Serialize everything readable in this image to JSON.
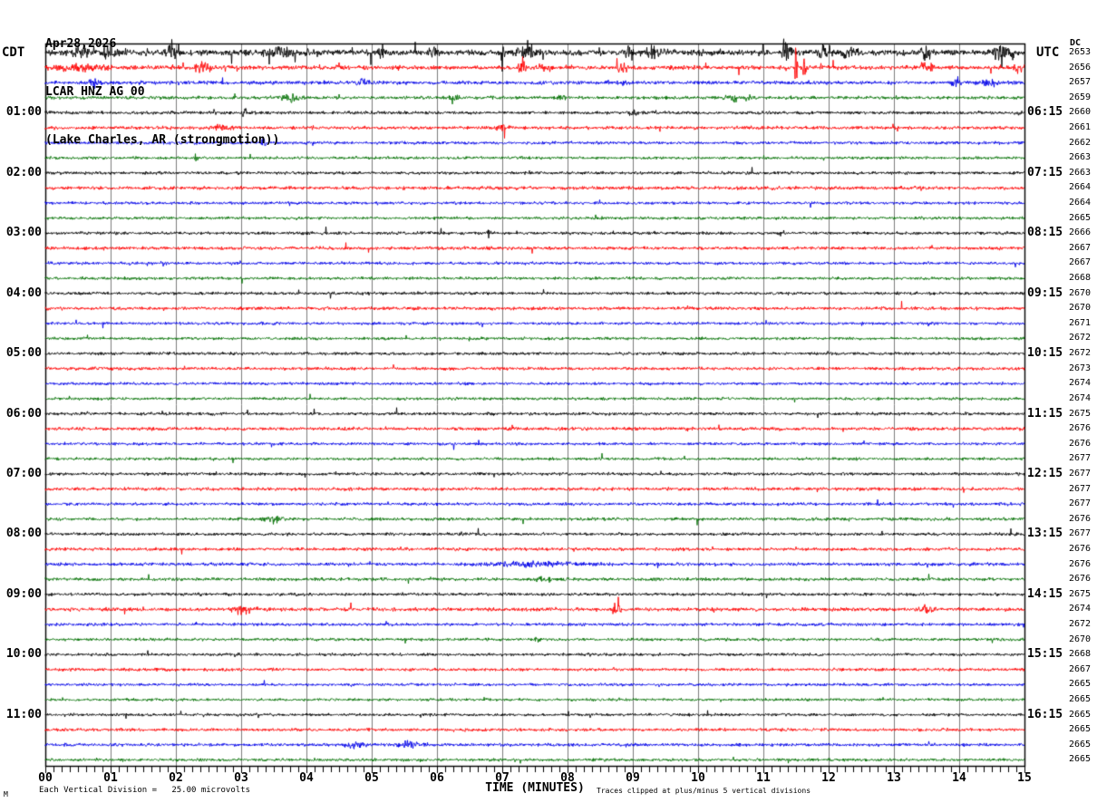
{
  "header": {
    "date_line": "Apr28,2026",
    "station_line": "LCAR HNZ AG 00",
    "location_line": "(Lake Charles, AR (strongmotion))",
    "left_timezone": "CDT",
    "right_timezone": "UTC",
    "dc_column_header": "DC"
  },
  "x_axis": {
    "title": "TIME (MINUTES)",
    "tick_labels": [
      "00",
      "01",
      "02",
      "03",
      "04",
      "05",
      "06",
      "07",
      "08",
      "09",
      "10",
      "11",
      "12",
      "13",
      "14",
      "15"
    ]
  },
  "footer": {
    "logo_mark": "M",
    "scale_label": "Each Vertical Division =",
    "scale_value": "25.00 microvolts",
    "clip_note": "Traces clipped at plus/minus 5 vertical divisions"
  },
  "colors": {
    "black": "#000000",
    "red": "#ff0000",
    "blue": "#0000e8",
    "green": "#006f00",
    "grid": "#7d7d7d",
    "border": "#000000",
    "background": "#ffffff"
  },
  "chart_data": {
    "type": "line",
    "subtype": "helicorder_seismogram",
    "minutes_per_line": 15,
    "x_range_minutes": [
      0,
      15
    ],
    "grid": "vertical-every-minute",
    "trace_color_cycle": [
      "black",
      "red",
      "blue",
      "green"
    ],
    "clip_divisions": 5,
    "microvolts_per_division": 25.0,
    "rows": [
      {
        "cdt": "",
        "utc": "",
        "dc": 2653,
        "color": "black",
        "amp": 3.0,
        "spk": 0.02,
        "events": [
          [
            0.55,
            5,
            0.08
          ],
          [
            1.0,
            7,
            0.07
          ],
          [
            1.95,
            9,
            0.06
          ],
          [
            3.6,
            4,
            0.15
          ],
          [
            5.15,
            7,
            0.04
          ],
          [
            5.95,
            5,
            0.05
          ],
          [
            7.0,
            30,
            0.015
          ],
          [
            7.35,
            6,
            0.1
          ],
          [
            8.95,
            12,
            0.03
          ],
          [
            9.3,
            5,
            0.1
          ],
          [
            11.35,
            8,
            0.05
          ],
          [
            11.9,
            8,
            0.04
          ],
          [
            12.3,
            5,
            0.1
          ],
          [
            13.5,
            6,
            0.05
          ],
          [
            14.65,
            6,
            0.1
          ]
        ]
      },
      {
        "cdt": "",
        "utc": "",
        "dc": 2656,
        "color": "red",
        "amp": 2.2,
        "spk": 0.01,
        "events": [
          [
            0.5,
            3,
            0.3
          ],
          [
            2.4,
            6,
            0.08
          ],
          [
            4.5,
            5,
            0.03
          ],
          [
            7.3,
            8,
            0.04
          ],
          [
            7.6,
            5,
            0.05
          ],
          [
            8.85,
            4,
            0.06
          ],
          [
            11.5,
            40,
            0.012
          ],
          [
            11.62,
            12,
            0.02
          ],
          [
            13.5,
            4,
            0.08
          ],
          [
            14.9,
            5,
            0.05
          ]
        ]
      },
      {
        "cdt": "",
        "utc": "",
        "dc": 2657,
        "color": "blue",
        "amp": 1.9,
        "spk": 0.008,
        "events": [
          [
            0.75,
            5,
            0.05
          ],
          [
            4.85,
            5,
            0.05
          ],
          [
            8.85,
            4,
            0.05
          ],
          [
            13.95,
            6,
            0.04
          ],
          [
            14.5,
            3,
            0.1
          ]
        ]
      },
      {
        "cdt": "",
        "utc": "",
        "dc": 2659,
        "color": "green",
        "amp": 1.7,
        "spk": 0.006,
        "events": [
          [
            3.75,
            4,
            0.1
          ],
          [
            6.25,
            6,
            0.04
          ],
          [
            7.9,
            4,
            0.05
          ],
          [
            10.6,
            3,
            0.15
          ]
        ]
      },
      {
        "cdt": "01:00",
        "utc": "06:15",
        "dc": 2660,
        "color": "black",
        "amp": 1.7,
        "spk": 0.006,
        "events": [
          [
            3.05,
            7,
            0.02
          ],
          [
            9.0,
            3,
            0.05
          ],
          [
            14.9,
            5,
            0.03
          ]
        ]
      },
      {
        "cdt": "",
        "utc": "",
        "dc": 2661,
        "color": "red",
        "amp": 1.8,
        "spk": 0.005,
        "events": [
          [
            2.7,
            3,
            0.1
          ],
          [
            7.0,
            3,
            0.05
          ]
        ]
      },
      {
        "cdt": "",
        "utc": "",
        "dc": 2662,
        "color": "blue",
        "amp": 1.6,
        "spk": 0.005,
        "events": [
          [
            3.35,
            6,
            0.025
          ]
        ]
      },
      {
        "cdt": "",
        "utc": "",
        "dc": 2663,
        "color": "green",
        "amp": 1.5,
        "spk": 0.005,
        "events": [
          [
            2.3,
            5,
            0.02
          ]
        ]
      },
      {
        "cdt": "02:00",
        "utc": "07:15",
        "dc": 2663,
        "color": "black",
        "amp": 1.6,
        "spk": 0.004,
        "events": []
      },
      {
        "cdt": "",
        "utc": "",
        "dc": 2664,
        "color": "red",
        "amp": 1.8,
        "spk": 0.005,
        "events": []
      },
      {
        "cdt": "",
        "utc": "",
        "dc": 2664,
        "color": "blue",
        "amp": 1.5,
        "spk": 0.004,
        "events": []
      },
      {
        "cdt": "",
        "utc": "",
        "dc": 2665,
        "color": "green",
        "amp": 1.5,
        "spk": 0.004,
        "events": []
      },
      {
        "cdt": "03:00",
        "utc": "08:15",
        "dc": 2666,
        "color": "black",
        "amp": 1.6,
        "spk": 0.004,
        "events": [
          [
            6.8,
            5,
            0.02
          ]
        ]
      },
      {
        "cdt": "",
        "utc": "",
        "dc": 2667,
        "color": "red",
        "amp": 1.7,
        "spk": 0.004,
        "events": []
      },
      {
        "cdt": "",
        "utc": "",
        "dc": 2667,
        "color": "blue",
        "amp": 1.5,
        "spk": 0.004,
        "events": []
      },
      {
        "cdt": "",
        "utc": "",
        "dc": 2668,
        "color": "green",
        "amp": 1.5,
        "spk": 0.004,
        "events": []
      },
      {
        "cdt": "04:00",
        "utc": "09:15",
        "dc": 2670,
        "color": "black",
        "amp": 1.6,
        "spk": 0.004,
        "events": []
      },
      {
        "cdt": "",
        "utc": "",
        "dc": 2670,
        "color": "red",
        "amp": 1.7,
        "spk": 0.004,
        "events": []
      },
      {
        "cdt": "",
        "utc": "",
        "dc": 2671,
        "color": "blue",
        "amp": 1.5,
        "spk": 0.004,
        "events": []
      },
      {
        "cdt": "",
        "utc": "",
        "dc": 2672,
        "color": "green",
        "amp": 1.5,
        "spk": 0.004,
        "events": []
      },
      {
        "cdt": "05:00",
        "utc": "10:15",
        "dc": 2672,
        "color": "black",
        "amp": 1.6,
        "spk": 0.004,
        "events": []
      },
      {
        "cdt": "",
        "utc": "",
        "dc": 2673,
        "color": "red",
        "amp": 1.7,
        "spk": 0.004,
        "events": []
      },
      {
        "cdt": "",
        "utc": "",
        "dc": 2674,
        "color": "blue",
        "amp": 1.5,
        "spk": 0.004,
        "events": []
      },
      {
        "cdt": "",
        "utc": "",
        "dc": 2674,
        "color": "green",
        "amp": 1.5,
        "spk": 0.004,
        "events": []
      },
      {
        "cdt": "06:00",
        "utc": "11:15",
        "dc": 2675,
        "color": "black",
        "amp": 1.6,
        "spk": 0.004,
        "events": []
      },
      {
        "cdt": "",
        "utc": "",
        "dc": 2676,
        "color": "red",
        "amp": 1.8,
        "spk": 0.005,
        "events": []
      },
      {
        "cdt": "",
        "utc": "",
        "dc": 2676,
        "color": "blue",
        "amp": 1.5,
        "spk": 0.004,
        "events": []
      },
      {
        "cdt": "",
        "utc": "",
        "dc": 2677,
        "color": "green",
        "amp": 1.5,
        "spk": 0.004,
        "events": []
      },
      {
        "cdt": "07:00",
        "utc": "12:15",
        "dc": 2677,
        "color": "black",
        "amp": 1.6,
        "spk": 0.004,
        "events": []
      },
      {
        "cdt": "",
        "utc": "",
        "dc": 2677,
        "color": "red",
        "amp": 1.7,
        "spk": 0.004,
        "events": []
      },
      {
        "cdt": "",
        "utc": "",
        "dc": 2677,
        "color": "blue",
        "amp": 1.6,
        "spk": 0.004,
        "events": []
      },
      {
        "cdt": "",
        "utc": "",
        "dc": 2676,
        "color": "green",
        "amp": 1.6,
        "spk": 0.004,
        "events": [
          [
            3.5,
            3,
            0.1
          ]
        ]
      },
      {
        "cdt": "08:00",
        "utc": "13:15",
        "dc": 2677,
        "color": "black",
        "amp": 1.6,
        "spk": 0.004,
        "events": []
      },
      {
        "cdt": "",
        "utc": "",
        "dc": 2676,
        "color": "red",
        "amp": 1.7,
        "spk": 0.004,
        "events": []
      },
      {
        "cdt": "",
        "utc": "",
        "dc": 2676,
        "color": "blue",
        "amp": 1.7,
        "spk": 0.005,
        "events": [
          [
            7.5,
            2,
            0.5
          ]
        ]
      },
      {
        "cdt": "",
        "utc": "",
        "dc": 2676,
        "color": "green",
        "amp": 1.7,
        "spk": 0.005,
        "events": [
          [
            7.6,
            3,
            0.1
          ]
        ]
      },
      {
        "cdt": "09:00",
        "utc": "14:15",
        "dc": 2675,
        "color": "black",
        "amp": 1.6,
        "spk": 0.004,
        "events": []
      },
      {
        "cdt": "",
        "utc": "",
        "dc": 2674,
        "color": "red",
        "amp": 1.9,
        "spk": 0.006,
        "events": [
          [
            3.0,
            5,
            0.1
          ],
          [
            8.75,
            5,
            0.05
          ],
          [
            13.5,
            4,
            0.06
          ]
        ]
      },
      {
        "cdt": "",
        "utc": "",
        "dc": 2672,
        "color": "blue",
        "amp": 1.6,
        "spk": 0.004,
        "events": []
      },
      {
        "cdt": "",
        "utc": "",
        "dc": 2670,
        "color": "green",
        "amp": 1.5,
        "spk": 0.004,
        "events": [
          [
            7.55,
            3,
            0.04
          ]
        ]
      },
      {
        "cdt": "10:00",
        "utc": "15:15",
        "dc": 2668,
        "color": "black",
        "amp": 1.5,
        "spk": 0.004,
        "events": []
      },
      {
        "cdt": "",
        "utc": "",
        "dc": 2667,
        "color": "red",
        "amp": 1.6,
        "spk": 0.004,
        "events": []
      },
      {
        "cdt": "",
        "utc": "",
        "dc": 2665,
        "color": "blue",
        "amp": 1.5,
        "spk": 0.004,
        "events": []
      },
      {
        "cdt": "",
        "utc": "",
        "dc": 2665,
        "color": "green",
        "amp": 1.4,
        "spk": 0.004,
        "events": []
      },
      {
        "cdt": "11:00",
        "utc": "16:15",
        "dc": 2665,
        "color": "black",
        "amp": 1.5,
        "spk": 0.004,
        "events": []
      },
      {
        "cdt": "",
        "utc": "",
        "dc": 2665,
        "color": "red",
        "amp": 1.6,
        "spk": 0.004,
        "events": []
      },
      {
        "cdt": "",
        "utc": "",
        "dc": 2665,
        "color": "blue",
        "amp": 1.6,
        "spk": 0.005,
        "events": [
          [
            4.75,
            4,
            0.1
          ],
          [
            5.6,
            3,
            0.15
          ]
        ]
      },
      {
        "cdt": "",
        "utc": "",
        "dc": 2665,
        "color": "green",
        "amp": 1.5,
        "spk": 0.004,
        "events": []
      }
    ]
  }
}
